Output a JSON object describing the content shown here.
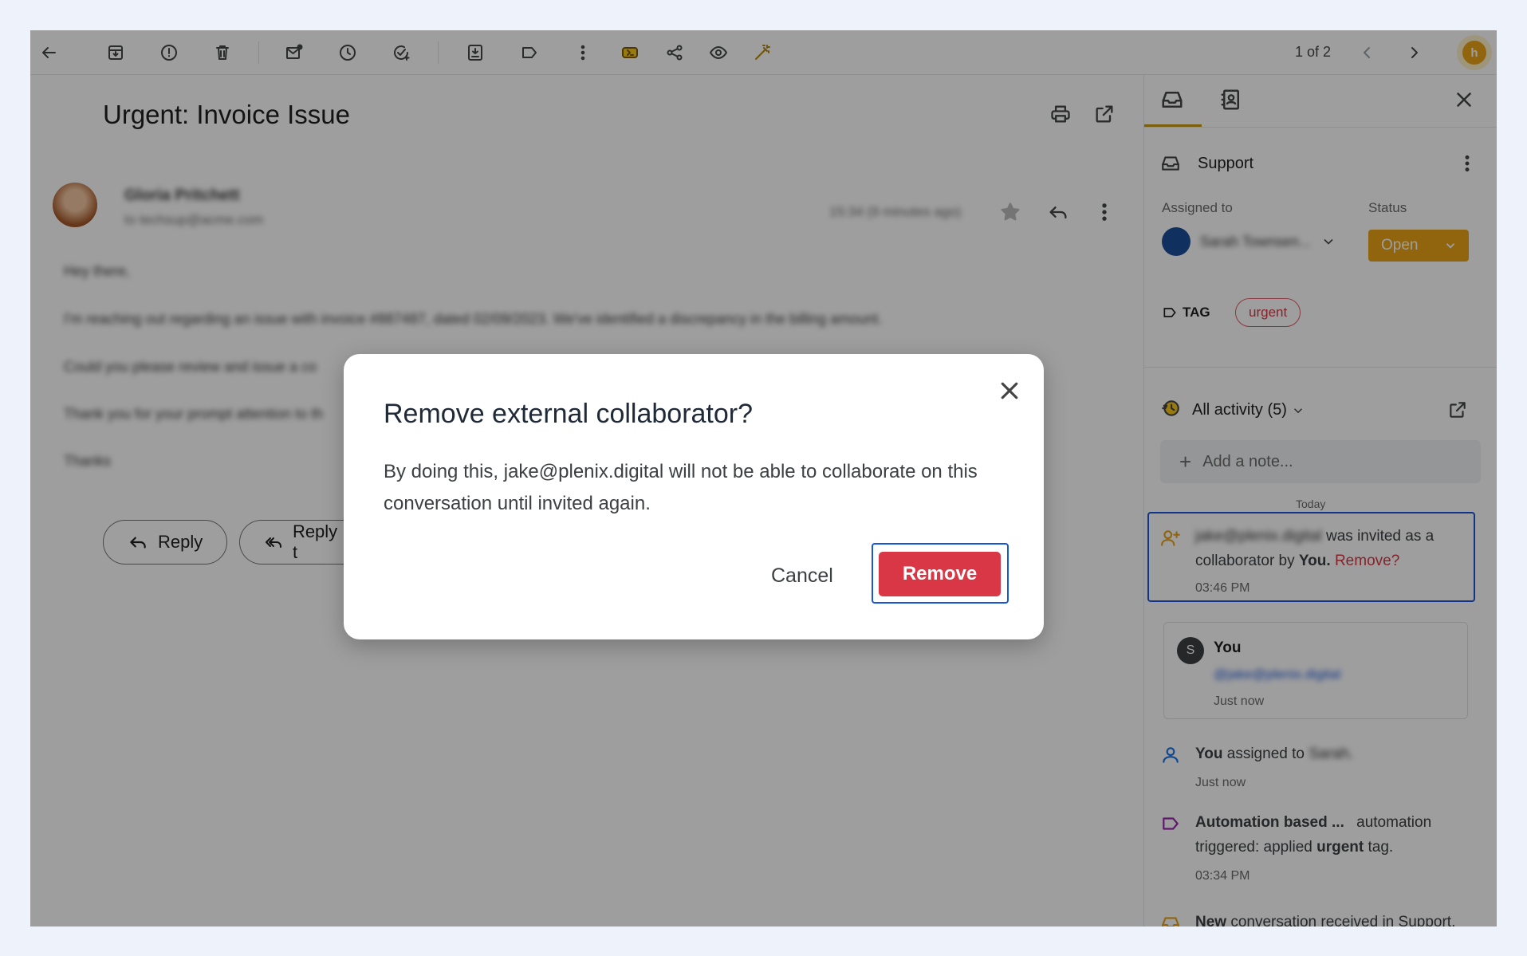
{
  "toolbar": {
    "pager": "1 of 2"
  },
  "email": {
    "subject": "Urgent: Invoice Issue",
    "sender_name": "Gloria Pritchett",
    "sender_email": "to techsup@acme.com",
    "timestamp": "15:34 (9 minutes ago)",
    "body_lines": [
      "Hey there,",
      "I'm reaching out regarding an issue with invoice #887487, dated 02/09/2023. We've identified a discrepancy in the billing amount.",
      "Could you please review and issue a co",
      "Thank you for your prompt attention to th",
      "Thanks"
    ],
    "reply_label": "Reply",
    "reply_all_label": "Reply t"
  },
  "side": {
    "inbox_name": "Support",
    "assigned_to_label": "Assigned to",
    "assignee_name": "Sarah Townsen...",
    "status_label": "Status",
    "status_value": "Open",
    "tag_label": "TAG",
    "tag_value": "urgent",
    "activity_title": "All activity (5)",
    "note_placeholder": "Add a note...",
    "today_label": "Today",
    "activities": {
      "invited_email": "jake@plenix.digital",
      "invited_text": "was invited as a collaborator by",
      "invited_by": "You.",
      "invited_remove": "Remove?",
      "invited_time": "03:46 PM",
      "comment_author": "You",
      "comment_author_initial": "S",
      "comment_mention": "@jake@plenix.digital",
      "comment_time": "Just now",
      "assigned_you": "You",
      "assigned_text": "assigned to",
      "assigned_name": "Sarah.",
      "assigned_time": "Just now",
      "automation_title": "Automation based ...",
      "automation_text1": "automation",
      "automation_text2": "triggered: applied",
      "automation_tag": "urgent",
      "automation_text3": "tag.",
      "automation_time": "03:34 PM",
      "new_conv_strong": "New",
      "new_conv_text": "conversation received in",
      "new_conv_inbox": "Support."
    }
  },
  "dialog": {
    "title": "Remove external collaborator?",
    "body": "By doing this, jake@plenix.digital will not be able to collaborate on this conversation until invited again.",
    "cancel_label": "Cancel",
    "remove_label": "Remove"
  },
  "colors": {
    "accent": "#e8a317",
    "danger": "#d93745",
    "focus": "#1a56db"
  }
}
